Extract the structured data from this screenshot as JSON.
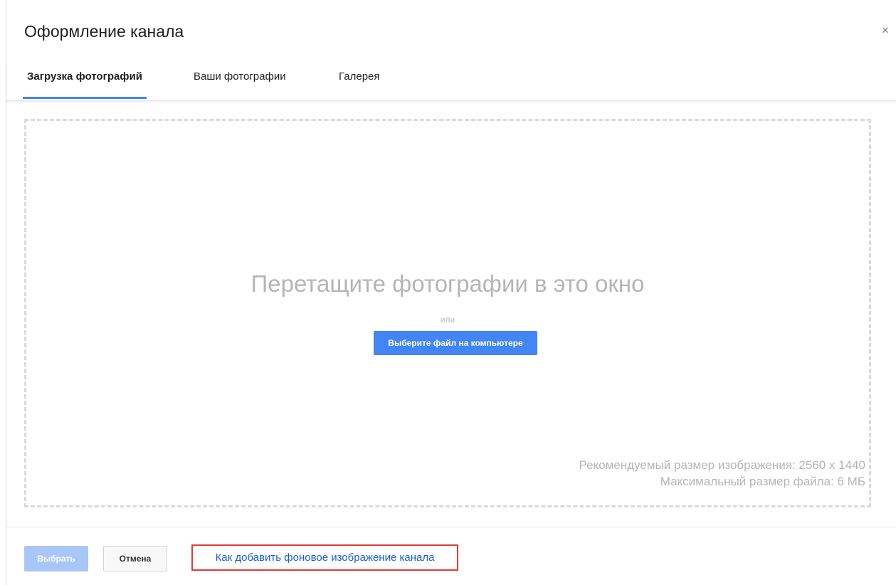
{
  "dialog": {
    "title": "Оформление канала",
    "close_glyph": "×"
  },
  "tabs": [
    {
      "label": "Загрузка фотографий",
      "active": true
    },
    {
      "label": "Ваши фотографии",
      "active": false
    },
    {
      "label": "Галерея",
      "active": false
    }
  ],
  "dropzone": {
    "title": "Перетащите фотографии в это окно",
    "or_text": "или",
    "choose_button": "Выберите файл на компьютере",
    "recommended_size": "Рекомендуемый размер изображения: 2560 x 1440",
    "max_file_size": "Максимальный размер файла: 6 МБ"
  },
  "footer": {
    "select_button": "Выбрать",
    "cancel_button": "Отмена",
    "help_link": "Как добавить фоновое изображение канала"
  },
  "colors": {
    "accent": "#4285f4",
    "select_disabled": "#a8c6f7",
    "highlight_box": "#e53935",
    "link": "#1a5fd1"
  }
}
